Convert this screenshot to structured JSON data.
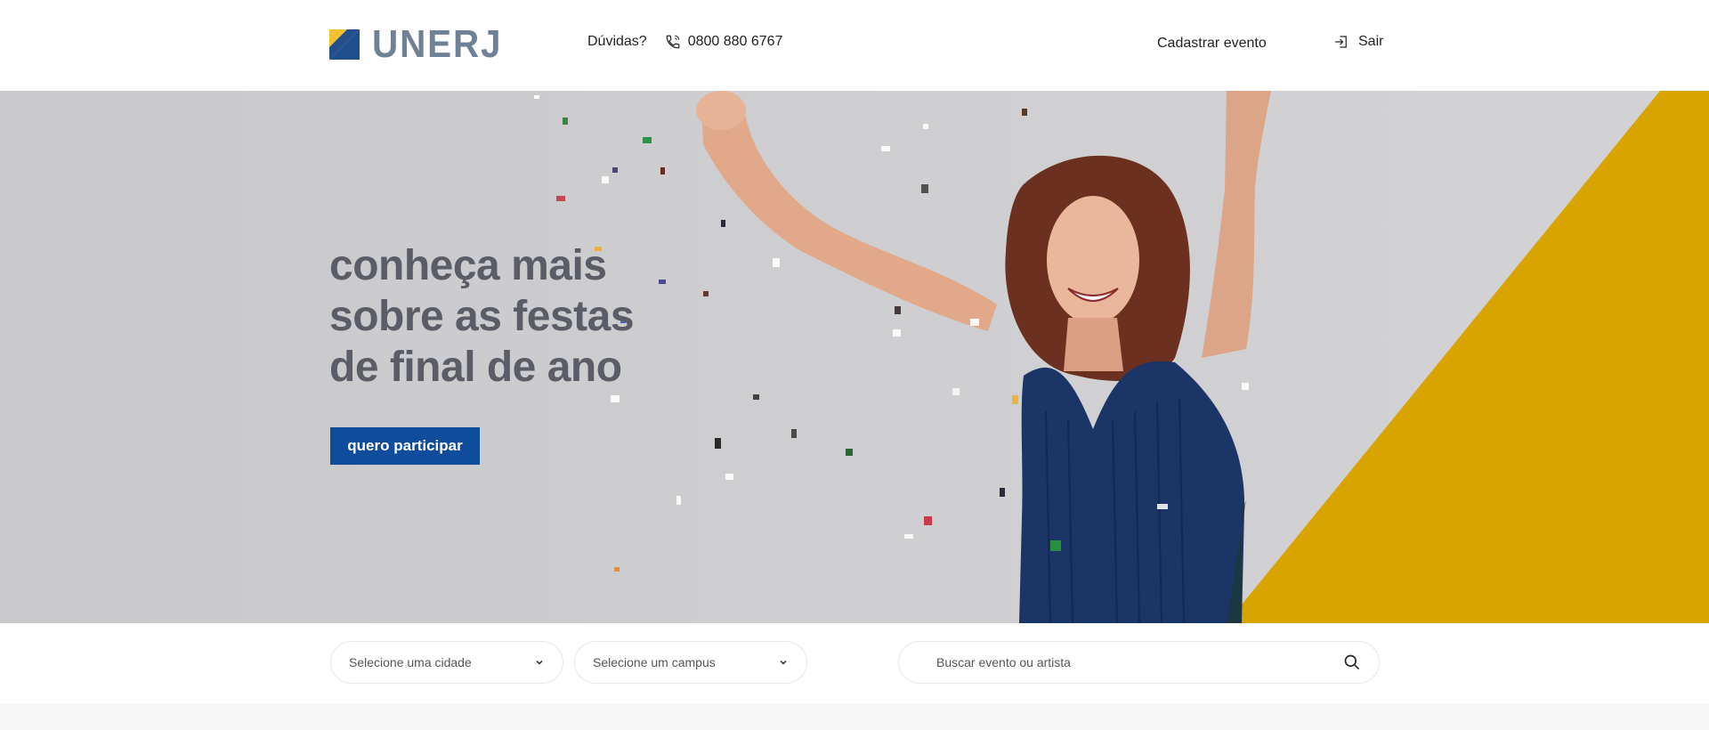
{
  "header": {
    "logo_text": "UNERJ",
    "help_label": "Dúvidas?",
    "phone": "0800 880 6767",
    "register_label": "Cadastrar evento",
    "logout_label": "Sair"
  },
  "hero": {
    "title_lines": [
      "conheça mais",
      "sobre as festas",
      "de final de ano"
    ],
    "cta_label": "quero participar"
  },
  "filters": {
    "city_select": "Selecione uma cidade",
    "campus_select": "Selecione um campus",
    "search_placeholder": "Buscar evento ou artista"
  },
  "colors": {
    "brand_blue": "#0f4c9c",
    "logo_gray": "#6f8196",
    "accent_yellow": "#d9a400",
    "hero_bg": "#cbcbcd"
  },
  "icons": {
    "phone": "phone-icon",
    "logout": "logout-icon",
    "chevron": "chevron-down-icon",
    "search": "search-icon"
  }
}
